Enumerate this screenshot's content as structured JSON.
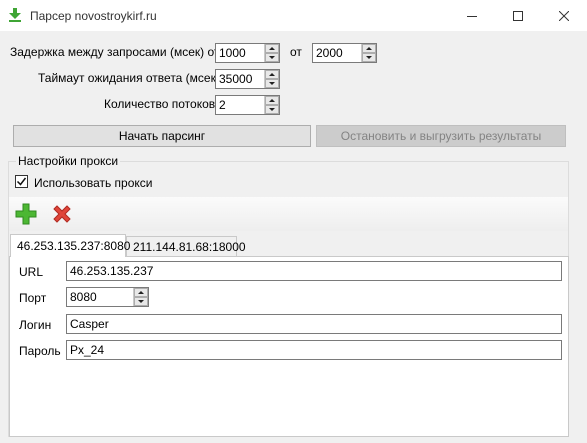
{
  "window": {
    "title": "Парсер novostroykirf.ru"
  },
  "delay": {
    "label": "Задержка между запросами (мсек) от",
    "from_value": "1000",
    "to_label": "от",
    "to_value": "2000"
  },
  "timeout": {
    "label": "Таймаут ожидания ответа (мсек)",
    "value": "35000"
  },
  "threads": {
    "label": "Количество потоков",
    "value": "2"
  },
  "buttons": {
    "start": "Начать парсинг",
    "stop": "Остановить и выгрузить результаты"
  },
  "proxy": {
    "group_title": "Настройки прокси",
    "use_label": "Использовать прокси",
    "use_checked": true,
    "tabs": [
      "46.253.135.237:8080",
      "211.144.81.68:18000"
    ],
    "active_tab": 0,
    "fields": {
      "url_label": "URL",
      "url_value": "46.253.135.237",
      "port_label": "Порт",
      "port_value": "8080",
      "login_label": "Логин",
      "login_value": "Casper",
      "password_label": "Пароль",
      "password_value": "Px_24"
    }
  },
  "icons": {
    "app": "download-icon",
    "add": "plus-icon",
    "remove": "cross-icon",
    "add_color": "#4cb733",
    "remove_color": "#e0453a"
  }
}
